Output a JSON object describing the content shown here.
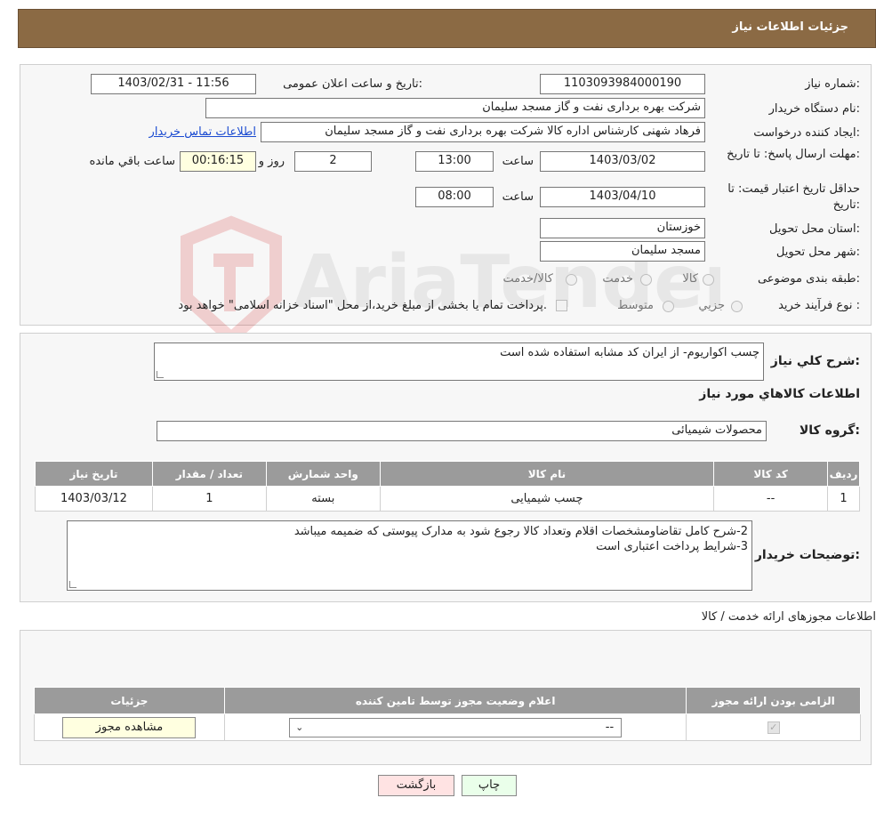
{
  "header": {
    "title": "جزئیات اطلاعات نیاز"
  },
  "form": {
    "need_number_label": "شماره نیاز:",
    "need_number": "1103093984000190",
    "announce_label": "تاریخ و ساعت اعلان عمومی:",
    "announce_value": "1403/02/31 - 11:56",
    "buyer_org_label": "نام دستگاه خریدار:",
    "buyer_org": "شرکت بهره برداری نفت و گاز مسجد سلیمان",
    "creator_label": "ایجاد کننده درخواست:",
    "creator": "فرهاد شهنی کارشناس اداره کالا  شرکت بهره برداری نفت و گاز مسجد سلیمان",
    "contact_link": "اطلاعات تماس خریدار",
    "reply_deadline_label": "مهلت ارسال پاسخ: تا تاریخ:",
    "reply_date": "1403/03/02",
    "time_label": "ساعت",
    "reply_time": "13:00",
    "days_value": "2",
    "days_label": "روز و",
    "remaining_time": "00:16:15",
    "remaining_label": "ساعت باقي مانده",
    "price_valid_label": "حداقل تاریخ اعتبار قیمت: تا تاریخ:",
    "price_valid_date": "1403/04/10",
    "price_valid_time": "08:00",
    "province_label": "استان محل تحویل:",
    "province": "خوزستان",
    "city_label": "شهر محل تحویل:",
    "city": "مسجد سلیمان",
    "category_label": "طبقه بندی موضوعی:",
    "category_options": [
      "کالا",
      "خدمت",
      "کالا/خدمت"
    ],
    "purchase_type_label": "نوع فرآیند خرید :",
    "purchase_options": [
      "جزيي",
      "متوسط"
    ],
    "purchase_note": "پرداخت تمام یا بخشی از مبلغ خرید،از محل \"اسناد خزانه اسلامی\" خواهد بود."
  },
  "description": {
    "label": "شرح کلي نياز:",
    "value": "چسب اکواریوم- از ایران کد مشابه استفاده شده است",
    "goods_info_title": "اطلاعات کالاهاي مورد نياز",
    "group_label": "گروه کالا:",
    "group_value": "محصولات شیمیائی"
  },
  "items_table": {
    "headers": [
      "رديف",
      "کد کالا",
      "نام کالا",
      "واحد شمارش",
      "تعداد / مقدار",
      "تاریخ نیاز"
    ],
    "rows": [
      [
        "1",
        "--",
        "چسب شیمیایی",
        "بسته",
        "1",
        "1403/03/12"
      ]
    ]
  },
  "buyer_notes": {
    "label": "توضیحات خریدار:",
    "line1": "2-شرح کامل تقاضاومشخصات اقلام وتعداد کالا رجوع شود به مدارک پیوستی که ضمیمه میباشد",
    "line2": "3-شرایط پرداخت اعتباری است"
  },
  "permits": {
    "title": "اطلاعات مجوزهای ارائه خدمت / کالا",
    "headers": [
      "الزامی بودن ارائه مجوز",
      "اعلام وضعیت مجوز توسط تامین کننده",
      "جزئیات"
    ],
    "select_value": "--",
    "view_button": "مشاهده مجوز"
  },
  "buttons": {
    "print": "چاپ",
    "back": "بازگشت"
  },
  "watermark": {
    "text": "AriaTender.neT"
  },
  "colors": {
    "header_bg": "#8b6a44",
    "table_header": "#9b9b9b",
    "print_btn": "#eaffea",
    "back_btn": "#ffe3e3"
  }
}
